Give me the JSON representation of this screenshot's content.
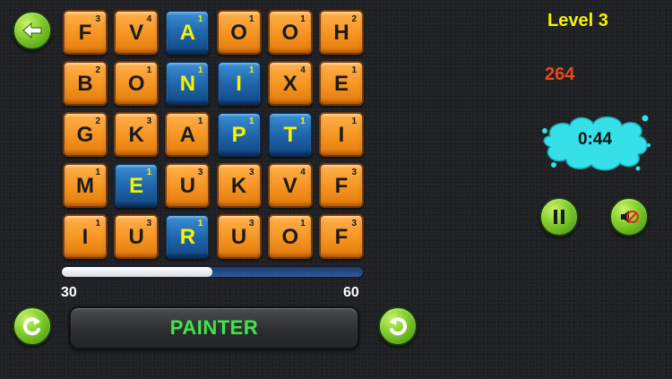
{
  "colors": {
    "tile_orange": "#f59420",
    "tile_blue": "#1e63a8",
    "selected_letter": "#f5f500",
    "word_green": "#3ee84a",
    "level_yellow": "#f5f500",
    "score_red": "#e84a1c",
    "timer_splash": "#36e0e8",
    "button_green": "#7fcb2a"
  },
  "board": {
    "rows": [
      [
        {
          "letter": "F",
          "points": "3",
          "selected": false
        },
        {
          "letter": "V",
          "points": "4",
          "selected": false
        },
        {
          "letter": "A",
          "points": "1",
          "selected": true
        },
        {
          "letter": "O",
          "points": "1",
          "selected": false
        },
        {
          "letter": "O",
          "points": "1",
          "selected": false
        },
        {
          "letter": "H",
          "points": "2",
          "selected": false
        }
      ],
      [
        {
          "letter": "B",
          "points": "2",
          "selected": false
        },
        {
          "letter": "O",
          "points": "1",
          "selected": false
        },
        {
          "letter": "N",
          "points": "1",
          "selected": true
        },
        {
          "letter": "I",
          "points": "1",
          "selected": true
        },
        {
          "letter": "X",
          "points": "4",
          "selected": false
        },
        {
          "letter": "E",
          "points": "1",
          "selected": false
        }
      ],
      [
        {
          "letter": "G",
          "points": "2",
          "selected": false
        },
        {
          "letter": "K",
          "points": "3",
          "selected": false
        },
        {
          "letter": "A",
          "points": "1",
          "selected": false
        },
        {
          "letter": "P",
          "points": "1",
          "selected": true
        },
        {
          "letter": "T",
          "points": "1",
          "selected": true
        },
        {
          "letter": "I",
          "points": "1",
          "selected": false
        }
      ],
      [
        {
          "letter": "M",
          "points": "1",
          "selected": false
        },
        {
          "letter": "E",
          "points": "1",
          "selected": true
        },
        {
          "letter": "U",
          "points": "3",
          "selected": false
        },
        {
          "letter": "K",
          "points": "3",
          "selected": false
        },
        {
          "letter": "V",
          "points": "4",
          "selected": false
        },
        {
          "letter": "F",
          "points": "3",
          "selected": false
        }
      ],
      [
        {
          "letter": "I",
          "points": "1",
          "selected": false
        },
        {
          "letter": "U",
          "points": "3",
          "selected": false
        },
        {
          "letter": "R",
          "points": "1",
          "selected": true
        },
        {
          "letter": "U",
          "points": "3",
          "selected": false
        },
        {
          "letter": "O",
          "points": "1",
          "selected": false
        },
        {
          "letter": "F",
          "points": "3",
          "selected": false
        }
      ]
    ]
  },
  "progress": {
    "min_label": "30",
    "max_label": "60",
    "fill_fraction": 0.5
  },
  "current_word": "PAINTER",
  "hud": {
    "level_label": "Level 3",
    "score": "264",
    "timer": "0:44"
  },
  "icons": {
    "back": "arrow-left-icon",
    "shuffle": "rotate-arrow-icon",
    "submit": "rotate-arrow-icon",
    "pause": "pause-icon",
    "mute": "speaker-muted-icon"
  }
}
